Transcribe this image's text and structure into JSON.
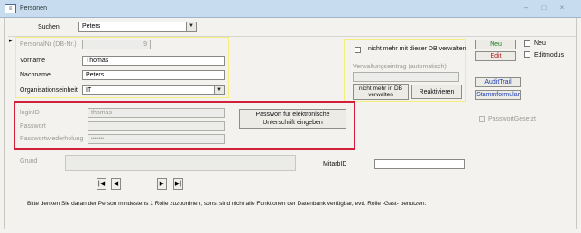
{
  "window": {
    "title": "Personen",
    "icon": "form-icon",
    "minimize": "–",
    "maximize": "□",
    "close": "×"
  },
  "header": {
    "search_label": "Suchen",
    "search_value": "Peters"
  },
  "record_marker": "▸",
  "form": {
    "personal_nr_label": "PersonalNr (DB-Nr.)",
    "personal_nr_value": "9",
    "vorname_label": "Vorname",
    "vorname_value": "Thomas",
    "nachname_label": "Nachname",
    "nachname_value": "Peters",
    "org_label": "Organisationseinheit",
    "org_value": "IT"
  },
  "db_panel": {
    "not_used_label": "nicht mehr mit dieser DB verwalten",
    "admin_entry_label": "Verwaltungseintrag (automatisch)",
    "not_in_db_button": "nicht mehr in DB verwalten",
    "reactivate_button": "Reaktivieren"
  },
  "actions": {
    "new_button": "Neu",
    "edit_button": "Edit",
    "new_checkbox_label": "Neu",
    "editmode_checkbox_label": "Editmodus",
    "audittrail_button": "AuditTrail",
    "stammformular_button": "Stammformular"
  },
  "login": {
    "login_label": "loginID",
    "login_value": "thomas",
    "password_label": "Passwort",
    "password_repeat_label": "Passwortwiederholung",
    "password_repeat_value": "••••••••",
    "e_signature_button": "Passwort für elektronische Unterschrift eingeben"
  },
  "password_set_label": "PasswortGesetzt",
  "grund_label": "Grund",
  "mitarbid_label": "MitarbID",
  "nav": {
    "first": "|◀",
    "prev": "◀",
    "next": "▶",
    "last": "▶|"
  },
  "footer_note": "Bitte denken Sie daran der Person mindestens 1 Rolle zuzuordnen, sonst sind nicht alle Funktionen der Datenbank verfügbar, evtl. Rolle -Gast- benutzen."
}
